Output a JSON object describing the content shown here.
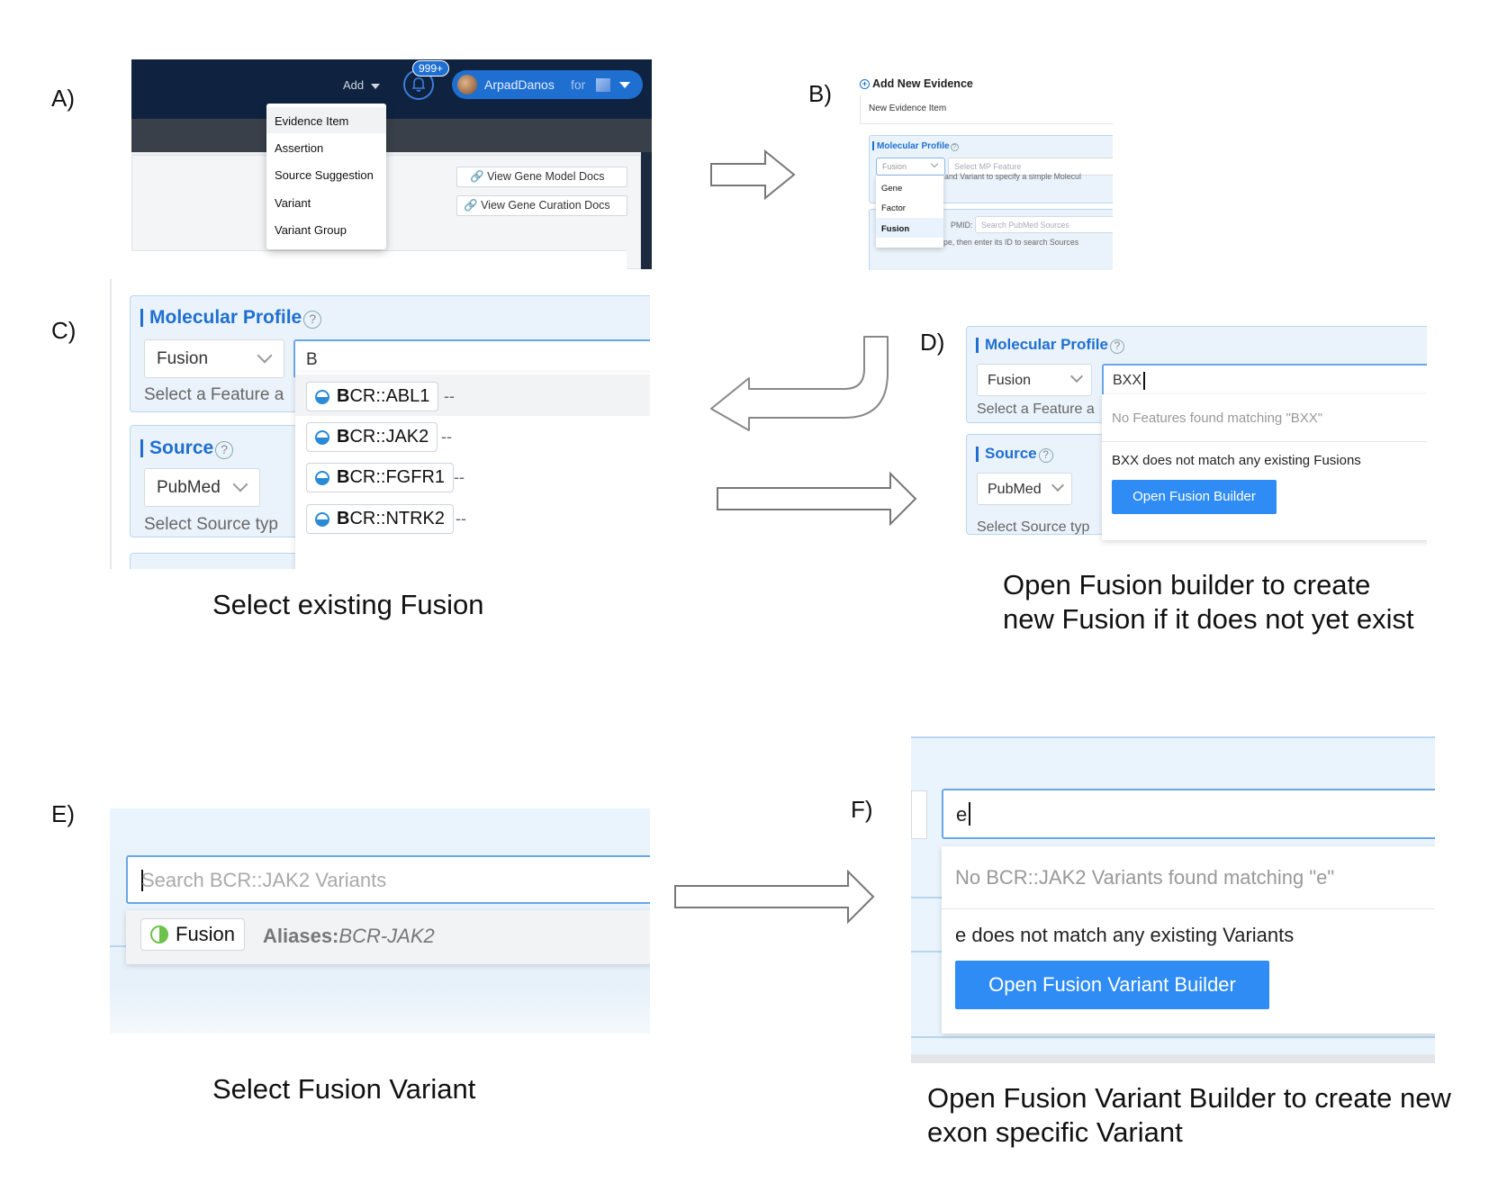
{
  "panel_labels": {
    "a": "A)",
    "b": "B)",
    "c": "C)",
    "d": "D)",
    "e": "E)",
    "f": "F)"
  },
  "panel_a": {
    "add_label": "Add",
    "notification_badge": "999+",
    "user_name": "ArpadDanos",
    "user_suffix": "for",
    "menu_items": [
      "Evidence Item",
      "Assertion",
      "Source Suggestion",
      "Variant",
      "Variant Group"
    ],
    "doc_buttons": [
      "View Gene Model Docs",
      "View Gene Curation Docs"
    ]
  },
  "panel_b": {
    "header": "Add New Evidence",
    "subheader": "New Evidence Item",
    "molecular_profile_label": "Molecular Profile",
    "type_select_value": "Fusion",
    "feature_placeholder": "Select MP Feature",
    "hint_text": "and Variant to specify a simple Molecul",
    "dropdown_options": [
      "Gene",
      "Factor",
      "Fusion"
    ],
    "pmid_label": "PMID:",
    "pmid_placeholder": "Search PubMed Sources",
    "source_hint": "pe, then enter its ID to search Sources"
  },
  "panel_c": {
    "molecular_profile_label": "Molecular Profile",
    "type_select_value": "Fusion",
    "search_value": "B",
    "feature_hint": "Select a Feature a",
    "source_label": "Source",
    "source_select_value": "PubMed",
    "source_hint": "Select Source typ",
    "results": [
      {
        "bold": "B",
        "rest": "CR::ABL1",
        "suffix": "--"
      },
      {
        "bold": "B",
        "rest": "CR::JAK2",
        "suffix": "--"
      },
      {
        "bold": "B",
        "rest": "CR::FGFR1",
        "suffix": "--"
      },
      {
        "bold": "B",
        "rest": "CR::NTRK2",
        "suffix": "--"
      }
    ],
    "caption": "Select existing Fusion"
  },
  "panel_d": {
    "molecular_profile_label": "Molecular Profile",
    "type_select_value": "Fusion",
    "search_value": "BXX",
    "feature_hint": "Select a Feature a",
    "no_match_text": "No Features found matching \"BXX\"",
    "does_not_match_text": "BXX does not match any existing Fusions",
    "builder_button": "Open Fusion Builder",
    "source_label": "Source",
    "source_select_value": "PubMed",
    "source_hint": "Select Source typ",
    "caption_lines": [
      "Open Fusion builder to create",
      "new Fusion if it does not yet exist"
    ]
  },
  "panel_e": {
    "search_placeholder": "Search BCR::JAK2 Variants",
    "result_tag": "Fusion",
    "aliases_label": "Aliases:",
    "aliases_value": "BCR-JAK2",
    "caption": "Select Fusion Variant"
  },
  "panel_f": {
    "search_value": "e",
    "no_match_text": "No BCR::JAK2 Variants found matching \"e\"",
    "does_not_match_text": "e does not match any existing Variants",
    "builder_button": "Open Fusion Variant Builder",
    "caption_lines": [
      "Open Fusion Variant Builder to create new",
      "exon specific Variant"
    ]
  },
  "colors": {
    "navbar": "#0f2340",
    "accent": "#1f6fd1",
    "button": "#2f8cf5",
    "panel_bg": "#e9f3fb"
  }
}
